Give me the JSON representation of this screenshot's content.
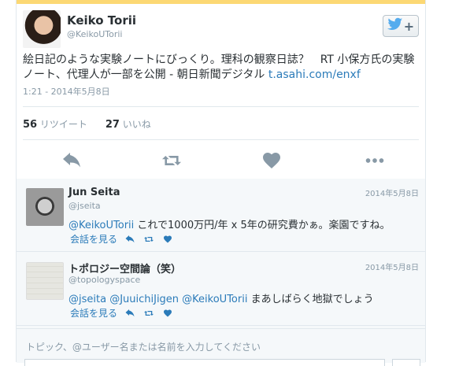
{
  "colors": {
    "accent": "#fcd874",
    "link": "#2b7bb9",
    "muted": "#8899a6",
    "text": "#292f33",
    "twitter_blue": "#55acee"
  },
  "tweet": {
    "author_name": "Keiko Torii",
    "author_handle": "@KeikoUTorii",
    "text_main": "絵日記のような実験ノートにびっくり。理科の観察日誌？　RT 小保方氏の実験ノート、代理人が一部を公開 - 朝日新聞デジタル ",
    "text_link": "t.asahi.com/enxf",
    "timestamp": "1:21 - 2014年5月8日",
    "retweet_count": "56",
    "retweet_label": "リツイート",
    "like_count": "27",
    "like_label": "いいね"
  },
  "follow_button": {
    "icon": "twitter-bird-icon",
    "plus": "+"
  },
  "actions": [
    "reply-icon",
    "retweet-icon",
    "heart-icon",
    "more-icon"
  ],
  "replies": [
    {
      "name": "Jun Seita",
      "handle": "@jseita",
      "date": "2014年5月8日",
      "mention": "@KeikoUTorii",
      "text": " これで1000万円/年 x 5年の研究費かぁ。楽園ですね。",
      "conversation_label": "会話を見る"
    },
    {
      "name": "トポロジー空間論（笑）",
      "handle": "@topologyspace",
      "date": "2014年5月8日",
      "mention": "@jseita @JuuichiJigen @KeikoUTorii",
      "text": " まあしばらく地獄でしょう",
      "conversation_label": "会話を見る"
    }
  ],
  "compose": {
    "placeholder": "トピック、@ユーザー名または名前を入力してください"
  }
}
